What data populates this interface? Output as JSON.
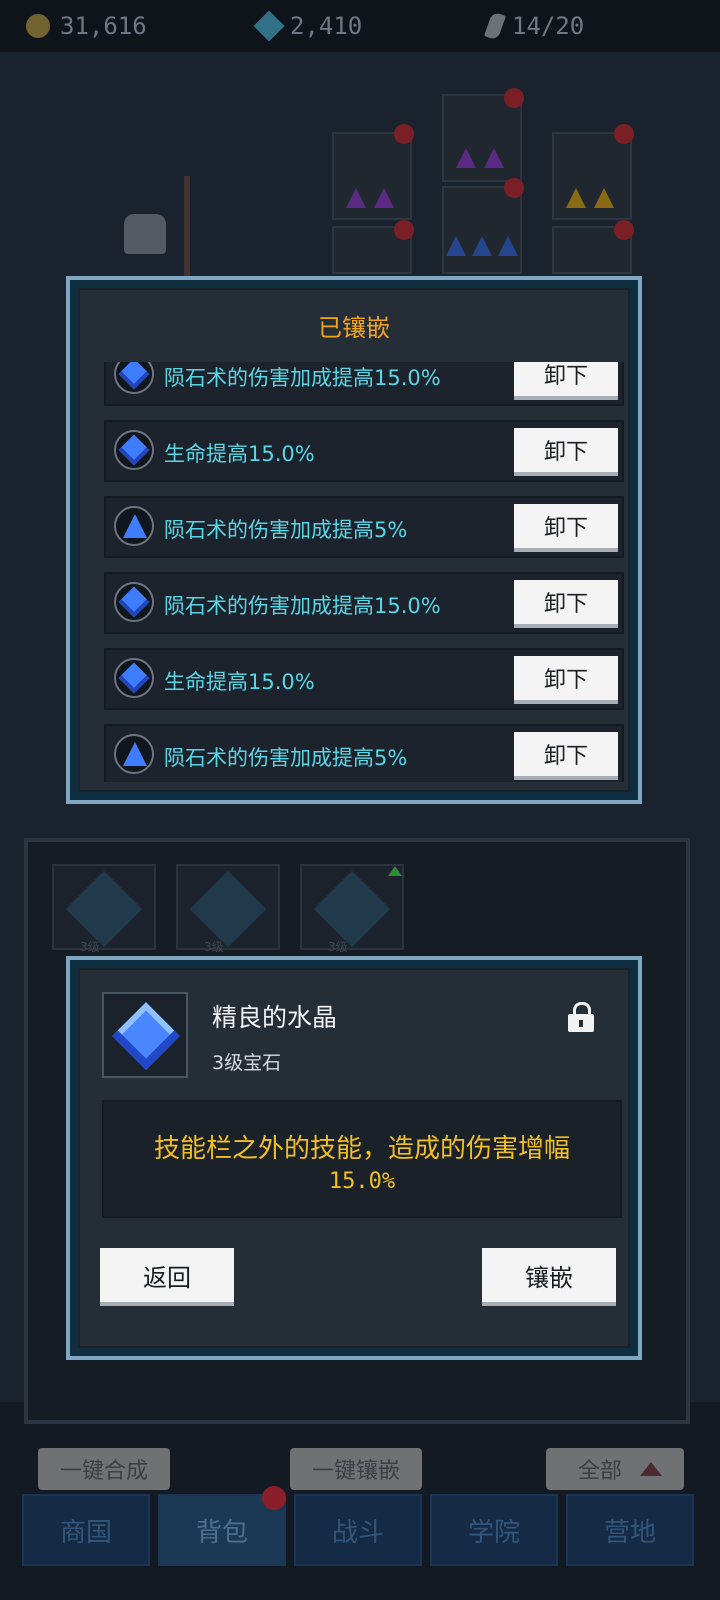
{
  "resources": {
    "gold": "31,616",
    "gems": "2,410",
    "energy": "14/20"
  },
  "background": {
    "inventory_level_labels": [
      "3级",
      "3级",
      "3级"
    ],
    "buttons": {
      "merge_all": "一键合成",
      "inlay_all": "一键镶嵌",
      "filter": "全部"
    },
    "nav": [
      "商国",
      "背包",
      "战斗",
      "学院",
      "营地"
    ]
  },
  "inlaid_dialog": {
    "title": "已镶嵌",
    "rows": [
      {
        "text": "陨石术的伤害加成提高15.0%",
        "icon": "diamond-gem-icon",
        "button": "卸下"
      },
      {
        "text": "生命提高15.0%",
        "icon": "diamond-gem-icon",
        "button": "卸下"
      },
      {
        "text": "陨石术的伤害加成提高5%",
        "icon": "triangle-gem-icon",
        "button": "卸下"
      },
      {
        "text": "陨石术的伤害加成提高15.0%",
        "icon": "diamond-gem-icon",
        "button": "卸下"
      },
      {
        "text": "生命提高15.0%",
        "icon": "diamond-gem-icon",
        "button": "卸下"
      },
      {
        "text": "陨石术的伤害加成提高5%",
        "icon": "triangle-gem-icon",
        "button": "卸下"
      }
    ]
  },
  "gem_detail": {
    "name": "精良的水晶",
    "level": "3级宝石",
    "description_line1": "技能栏之外的技能，造成的伤害增幅",
    "description_line2": "15.0%",
    "back_button": "返回",
    "inlay_button": "镶嵌"
  },
  "colors": {
    "dialog_border": "#7fa7c1",
    "title_orange": "#f0a51c",
    "effect_cyan": "#57d6e6",
    "description_yellow": "#f2bf22",
    "gem_blue": "#3f7dff"
  }
}
